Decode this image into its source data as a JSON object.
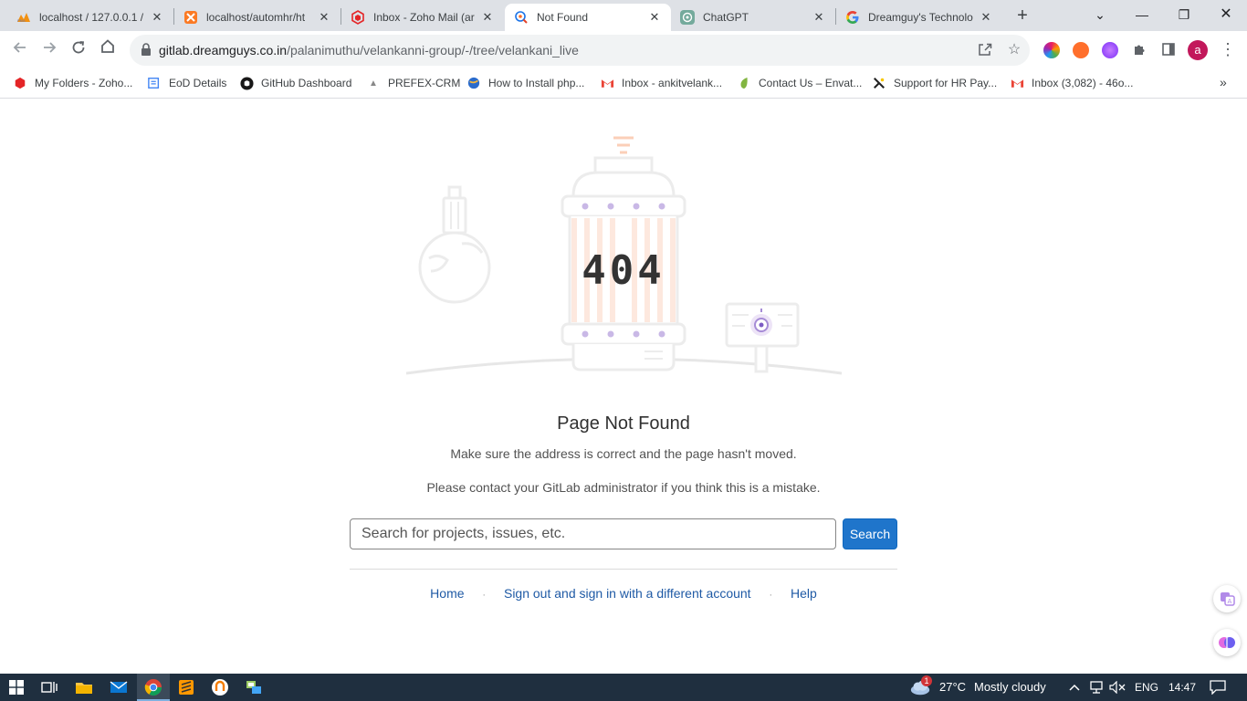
{
  "tabs": [
    {
      "title": "localhost / 127.0.0.1 /",
      "icon": "phpmyadmin-icon"
    },
    {
      "title": "localhost/automhr/ht",
      "icon": "xampp-icon"
    },
    {
      "title": "Inbox - Zoho Mail (ar",
      "icon": "zoho-icon"
    },
    {
      "title": "Not Found",
      "icon": "gitlab-loading-icon"
    },
    {
      "title": "ChatGPT",
      "icon": "chatgpt-icon"
    },
    {
      "title": "Dreamguy's Technolo",
      "icon": "google-icon"
    }
  ],
  "window_controls": {
    "tab_search": "⌄",
    "minimize": "—",
    "restore": "❐",
    "close": "✕"
  },
  "address_bar": {
    "host": "gitlab.dreamguys.co.in",
    "path": "/palanimuthu/velankanni-group/-/tree/velankani_live"
  },
  "profile_initial": "a",
  "bookmarks": [
    {
      "label": "My Folders - Zoho...",
      "icon": "zoho-icon"
    },
    {
      "label": "EoD Details",
      "icon": "form-icon"
    },
    {
      "label": "GitHub Dashboard",
      "icon": "github-icon"
    },
    {
      "label": "PREFEX-CRM",
      "icon": "prefex-icon"
    },
    {
      "label": "How to Install php...",
      "icon": "globe-icon"
    },
    {
      "label": "Inbox - ankitvelank...",
      "icon": "gmail-icon"
    },
    {
      "label": "Contact Us – Envat...",
      "icon": "envato-icon"
    },
    {
      "label": "Support for HR Pay...",
      "icon": "hr-icon"
    },
    {
      "label": "Inbox (3,082) - 46o...",
      "icon": "gmail-icon"
    }
  ],
  "error_code": "404",
  "page": {
    "title": "Page Not Found",
    "message": "Make sure the address is correct and the page hasn't moved.",
    "admin_message": "Please contact your GitLab administrator if you think this is a mistake.",
    "search_placeholder": "Search for projects, issues, etc.",
    "search_button": "Search",
    "links": {
      "home": "Home",
      "sign_out": "Sign out and sign in with a different account",
      "help": "Help"
    },
    "separator": "·"
  },
  "taskbar": {
    "weather_temp": "27°C",
    "weather_text": "Mostly cloudy",
    "weather_badge": "1",
    "language": "ENG",
    "time": "14:47"
  },
  "colors": {
    "accent": "#1f75cb",
    "link": "#1f5aa5",
    "taskbar": "#1f2f3f"
  }
}
